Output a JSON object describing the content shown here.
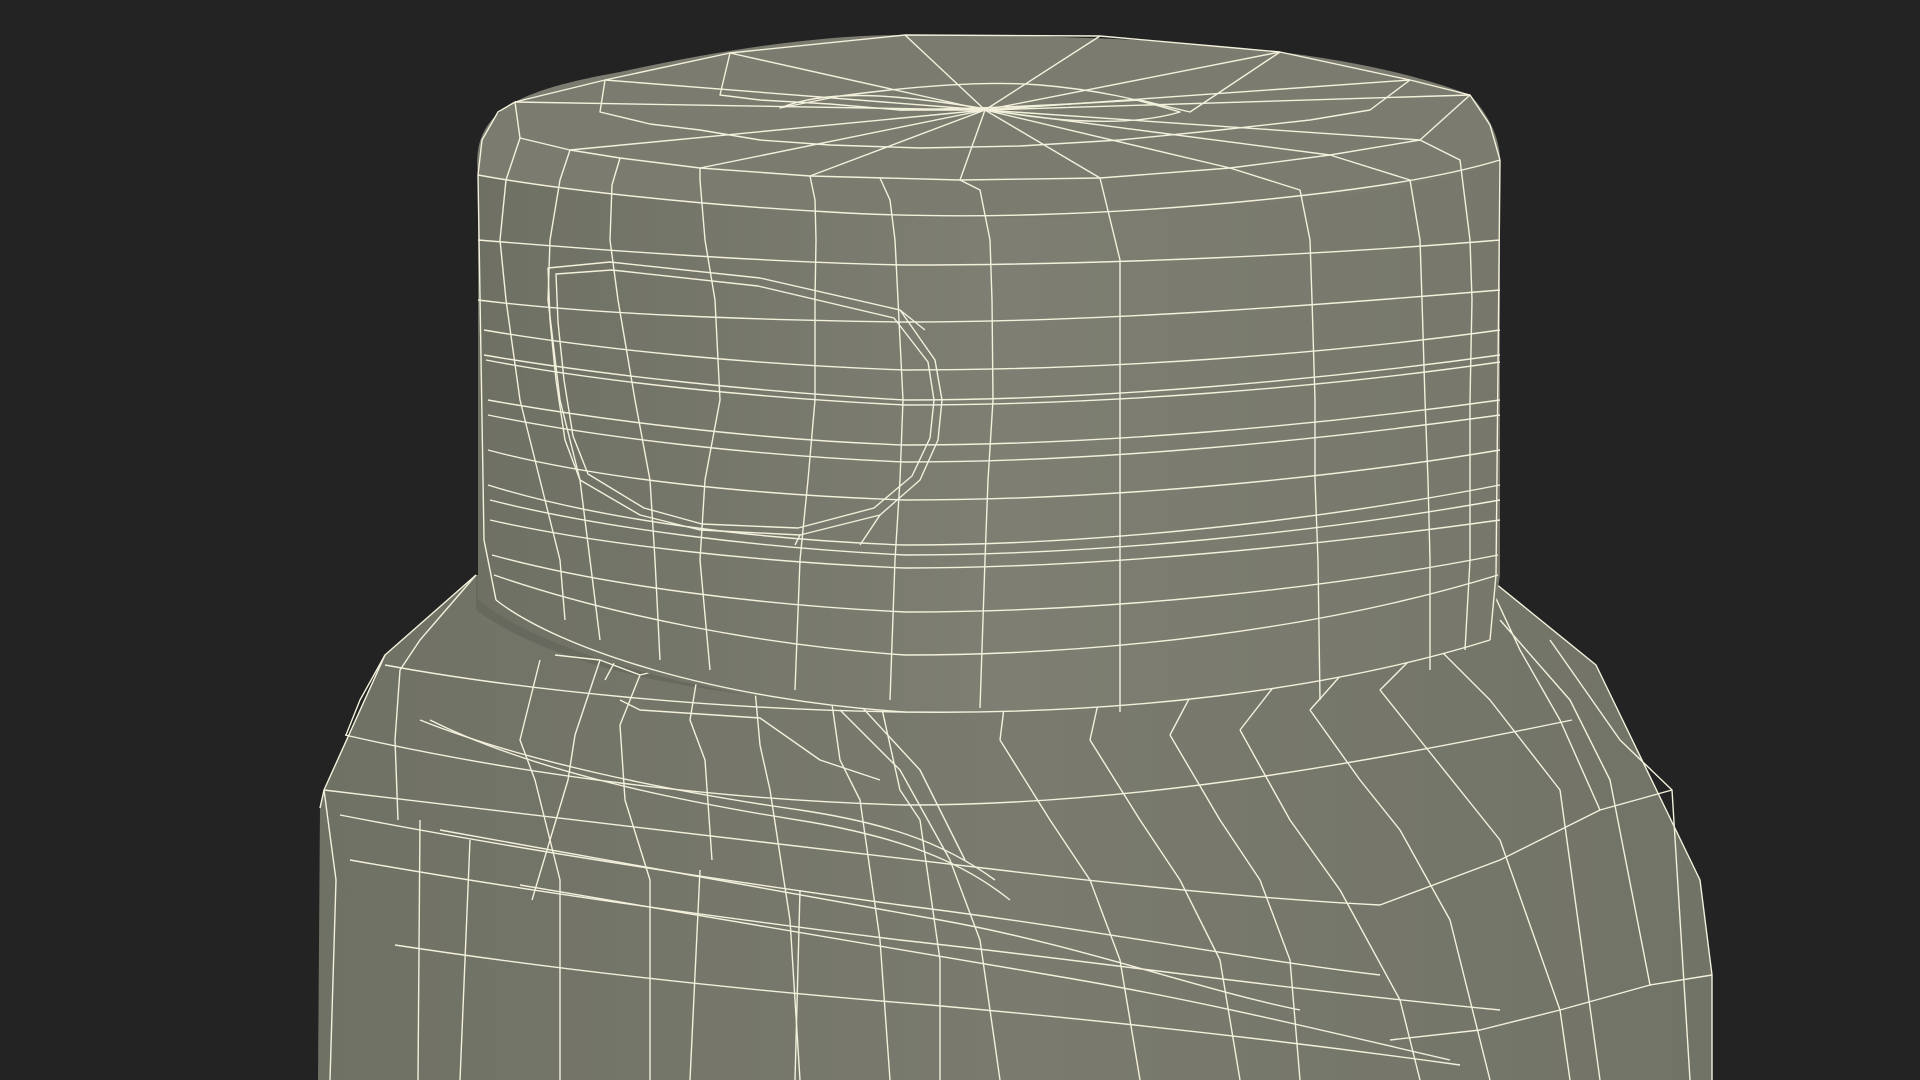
{
  "scene": {
    "background_color": "#232323",
    "surface_color": "#7b7c6f",
    "surface_shadow_color": "#5f6055",
    "wire_color": "#f3f1dc",
    "objects": [
      "bottle-cap",
      "bottle-shoulder",
      "bottle-body"
    ]
  }
}
